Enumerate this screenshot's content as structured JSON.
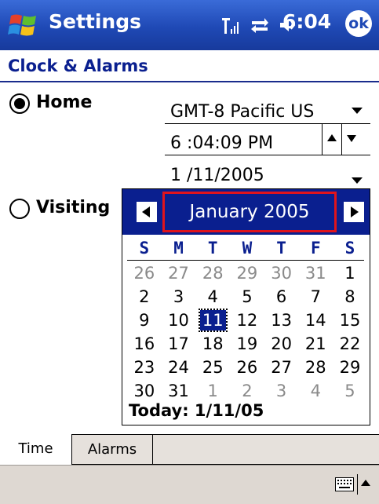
{
  "title_bar": {
    "app_title": "Settings",
    "time": "6:04",
    "ok_label": "ok"
  },
  "page": {
    "heading": "Clock & Alarms"
  },
  "home": {
    "label": "Home",
    "selected": true,
    "timezone": "GMT-8 Pacific US",
    "time_value": "6 :04:09 PM",
    "date_value": "1 /11/2005"
  },
  "visiting": {
    "label": "Visiting",
    "selected": false
  },
  "calendar": {
    "month_title": "January 2005",
    "weekdays": [
      "S",
      "M",
      "T",
      "W",
      "T",
      "F",
      "S"
    ],
    "weeks": [
      [
        "26",
        "27",
        "28",
        "29",
        "30",
        "31",
        "1"
      ],
      [
        "2",
        "3",
        "4",
        "5",
        "6",
        "7",
        "8"
      ],
      [
        "9",
        "10",
        "11",
        "12",
        "13",
        "14",
        "15"
      ],
      [
        "16",
        "17",
        "18",
        "19",
        "20",
        "21",
        "22"
      ],
      [
        "23",
        "24",
        "25",
        "26",
        "27",
        "28",
        "29"
      ],
      [
        "30",
        "31",
        "1",
        "2",
        "3",
        "4",
        "5"
      ]
    ],
    "today_text": "Today: 1/11/05",
    "selected_day": "11"
  },
  "tabs": [
    {
      "label": "Time",
      "active": true
    },
    {
      "label": "Alarms",
      "active": false
    }
  ],
  "icons": {
    "start": "windows-flag-icon",
    "signal": "signal-strength-icon",
    "connectivity": "connection-arrows-icon",
    "volume": "speaker-volume-icon",
    "keyboard": "keyboard-icon"
  },
  "colors": {
    "title_bar": "#1f49b5",
    "calendar_header": "#0a1f8f",
    "highlight_box": "#e0141c",
    "heading_text": "#0a1f8f"
  }
}
